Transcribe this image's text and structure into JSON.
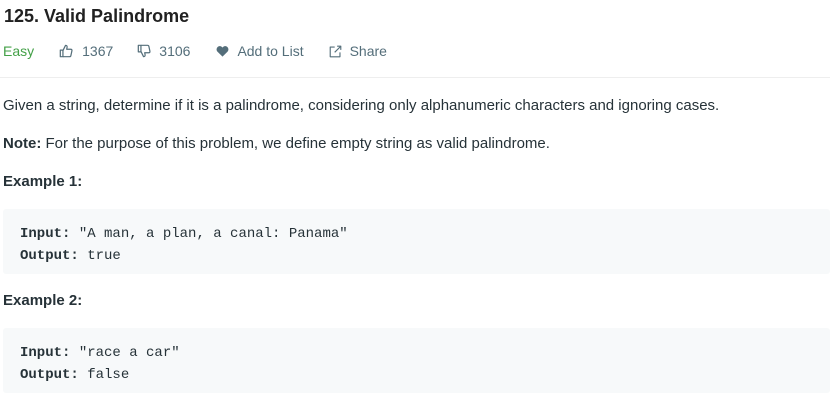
{
  "problem": {
    "title": "125. Valid Palindrome",
    "difficulty": "Easy",
    "likes": "1367",
    "dislikes": "3106",
    "add_to_list": "Add to List",
    "share": "Share"
  },
  "description": {
    "text": "Given a string, determine if it is a palindrome, considering only alphanumeric characters and ignoring cases.",
    "note_label": "Note:",
    "note_text": " For the purpose of this problem, we define empty string as valid palindrome."
  },
  "examples": [
    {
      "heading": "Example 1:",
      "input_label": "Input:",
      "input_value": " \"A man, a plan, a canal: Panama\"",
      "output_label": "Output:",
      "output_value": " true"
    },
    {
      "heading": "Example 2:",
      "input_label": "Input:",
      "input_value": " \"race a car\"",
      "output_label": "Output:",
      "output_value": " false"
    }
  ],
  "colors": {
    "easy": "#43a047",
    "meta": "#546e7a",
    "code_bg": "#f7f9fa"
  },
  "icons": {
    "likes": "thumbs-up-icon",
    "dislikes": "thumbs-down-icon",
    "add_to_list": "heart-icon",
    "share": "share-icon"
  }
}
